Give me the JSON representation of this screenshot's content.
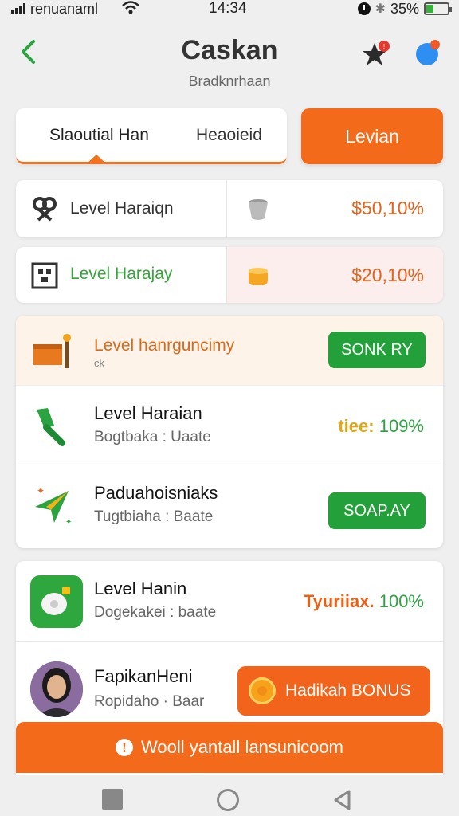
{
  "status_bar": {
    "carrier": "renuanaml",
    "time": "14:34",
    "battery": "35%",
    "battery_level": 0.35
  },
  "header": {
    "title": "Caskan",
    "subtitle": "Bradknrhaan"
  },
  "tabs": [
    {
      "label": "Slaoutial Han"
    },
    {
      "label": "Heaoieid"
    }
  ],
  "top_button": {
    "label": "Levian"
  },
  "level_rows": [
    {
      "label": "Level Haraiqn",
      "value": "$50,10%",
      "icon": "pretzel-icon",
      "mid_icon": "cup-icon"
    },
    {
      "label": "Level Harajay",
      "value": "$20,10%",
      "icon": "grid-box-icon",
      "mid_icon": "coin-cup-icon"
    }
  ],
  "list": [
    {
      "title": "Level hanrguncimy",
      "sub": "ck",
      "button": "SONK RY",
      "icon": "hammer-crate-icon"
    },
    {
      "title": "Level Haraian",
      "sub": "Bogtbaka : Uaate",
      "value_prefix": "tiee:",
      "value": "109%",
      "icon": "green-brush-icon"
    },
    {
      "title": "Paduahoisniaks",
      "sub": "Tugtbiaha : Baate",
      "button": "SOAP.AY",
      "icon": "sparkle-plane-icon"
    }
  ],
  "bottom": [
    {
      "title": "Level Hanin",
      "sub": "Dogekakei : baate",
      "value_prefix": "Tyuriiax.",
      "value": "100%",
      "icon": "app-tile-icon"
    },
    {
      "title": "FapikanHeni",
      "sub": "Ropidaho · Baar",
      "button": "Hadikah BONUS",
      "icon": "avatar"
    }
  ],
  "banner": {
    "label": "Wooll yantall lansunicoom"
  },
  "colors": {
    "accent_orange": "#f26a1a",
    "accent_green": "#23a03a",
    "background": "#efefef"
  }
}
